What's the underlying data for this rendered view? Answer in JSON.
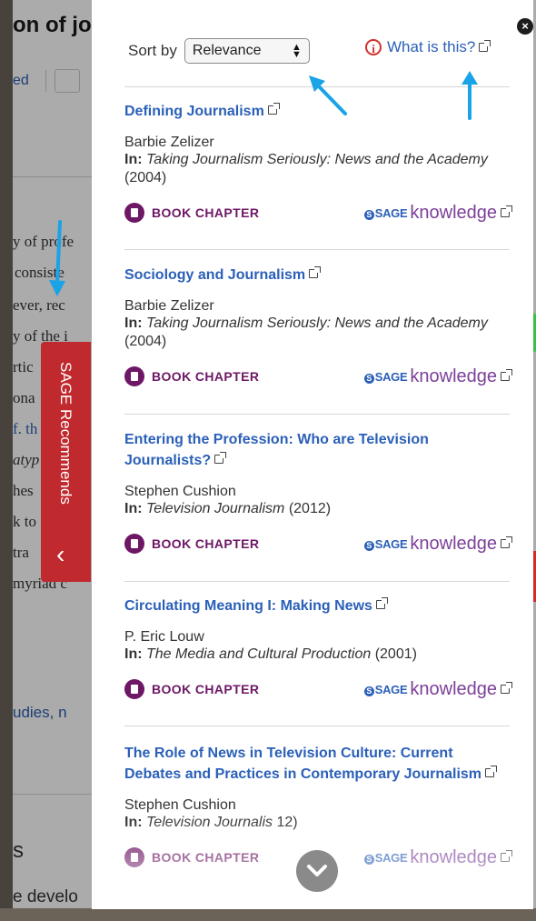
{
  "background_page": {
    "title_fragment": "on of jo",
    "top_links": [
      "ed",
      "c"
    ],
    "text_fragments": [
      "y of profe",
      "consiste",
      "ever, rec",
      "y of the i",
      "rtic",
      "ona",
      "f. th",
      "atyp",
      "hes",
      "k to",
      "tra",
      "myriad c",
      "udies, n",
      "s",
      "e develo"
    ]
  },
  "panel": {
    "sort_label": "Sort by",
    "sort_value": "Relevance",
    "what_is_this": "What is this?",
    "info_icon_glyph": "i",
    "close_glyph": "×",
    "items": [
      {
        "title": "Defining Journalism",
        "author": "Barbie Zelizer",
        "in_label": "In:",
        "source": "Taking Journalism Seriously: News and the Academy",
        "year": "(2004)",
        "type": "BOOK CHAPTER",
        "provider_brand": "SAGE",
        "provider_product": "knowledge"
      },
      {
        "title": "Sociology and Journalism",
        "author": "Barbie Zelizer",
        "in_label": "In:",
        "source": "Taking Journalism Seriously: News and the Academy",
        "year": "(2004)",
        "type": "BOOK CHAPTER",
        "provider_brand": "SAGE",
        "provider_product": "knowledge"
      },
      {
        "title": "Entering the Profession: Who are Television Journalists?",
        "author": "Stephen Cushion",
        "in_label": "In:",
        "source": "Television Journalism",
        "year": "(2012)",
        "type": "BOOK CHAPTER",
        "provider_brand": "SAGE",
        "provider_product": "knowledge"
      },
      {
        "title": "Circulating Meaning I: Making News",
        "author": "P. Eric Louw",
        "in_label": "In:",
        "source": "The Media and Cultural Production",
        "year": "(2001)",
        "type": "BOOK CHAPTER",
        "provider_brand": "SAGE",
        "provider_product": "knowledge"
      },
      {
        "title": "The Role of News in Television Culture: Current Debates and Practices in Contemporary Journalism",
        "author": "Stephen Cushion",
        "in_label": "In:",
        "source": "Television Journalis",
        "year": "12)",
        "type": "BOOK CHAPTER",
        "provider_brand": "SAGE",
        "provider_product": "knowledge"
      }
    ]
  },
  "side_tab": {
    "label": "SAGE Recommends",
    "chevron": "‹"
  },
  "icons": {
    "sort_arrows": [
      "▲",
      "▼"
    ],
    "external_link": "external-link-icon",
    "book": "book-icon",
    "scroll_down": "chevron-down-icon",
    "lock": "unlock-icon"
  },
  "colors": {
    "link_blue": "#2b60b8",
    "chapter_purple": "#6d1765",
    "tab_red": "#c0292d",
    "lock_green": "#3bbf4b",
    "annotation_arrow": "#1aa3e6"
  }
}
